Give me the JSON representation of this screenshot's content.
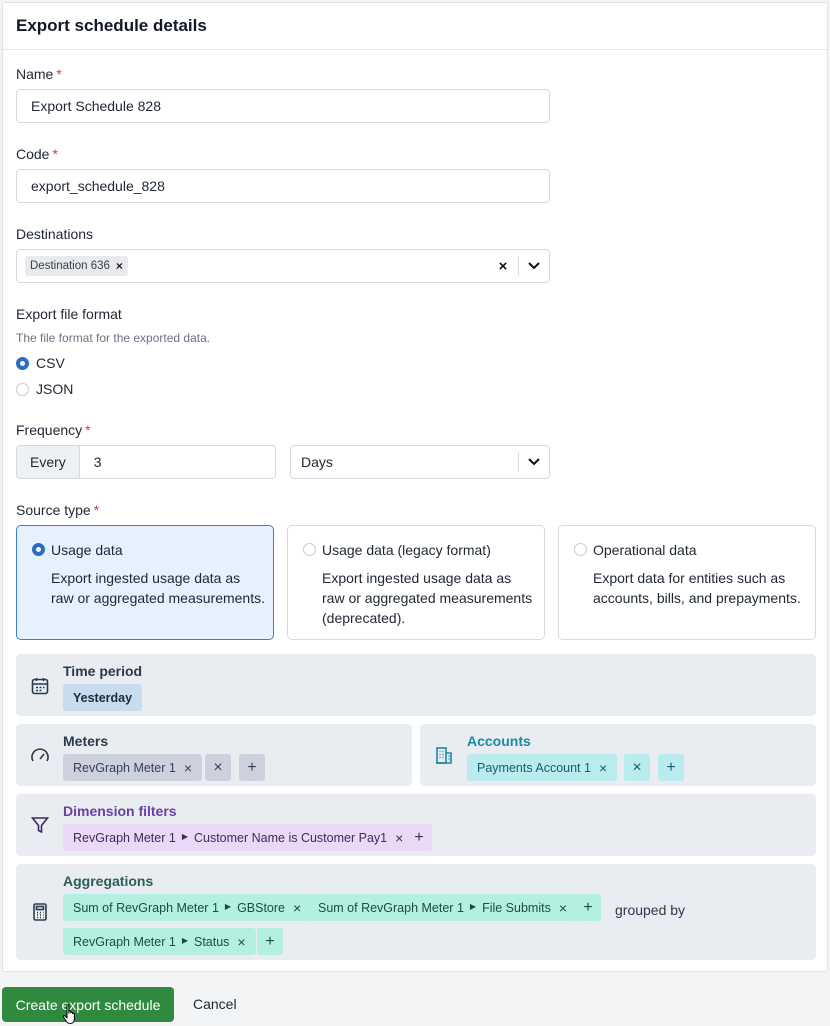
{
  "card": {
    "title": "Export schedule details"
  },
  "name": {
    "label": "Name",
    "required": "*",
    "value": "Export Schedule 828"
  },
  "code": {
    "label": "Code",
    "required": "*",
    "value": "export_schedule_828"
  },
  "destinations": {
    "label": "Destinations",
    "chips": [
      "Destination 636"
    ]
  },
  "file_format": {
    "label": "Export file format",
    "help": "The file format for the exported data.",
    "options": [
      {
        "label": "CSV",
        "selected": true
      },
      {
        "label": "JSON",
        "selected": false
      }
    ]
  },
  "frequency": {
    "label": "Frequency",
    "required": "*",
    "prefix": "Every",
    "value": "3",
    "unit": "Days"
  },
  "source_type": {
    "label": "Source type",
    "required": "*",
    "options": [
      {
        "title": "Usage data",
        "description": "Export ingested usage data as raw or aggregated measurements.",
        "selected": true
      },
      {
        "title": "Usage data (legacy format)",
        "description": "Export ingested usage data as raw or aggregated measurements (deprecated).",
        "selected": false
      },
      {
        "title": "Operational data",
        "description": "Export data for entities such as accounts, bills, and prepayments.",
        "selected": false
      }
    ]
  },
  "time_period": {
    "title": "Time period",
    "value": "Yesterday",
    "icon": "calendar-icon"
  },
  "meters": {
    "title": "Meters",
    "chips": [
      "RevGraph Meter 1"
    ],
    "icon": "gauge-icon"
  },
  "accounts": {
    "title": "Accounts",
    "chips": [
      "Payments Account 1"
    ],
    "icon": "building-icon"
  },
  "dimension_filters": {
    "title": "Dimension filters",
    "icon": "filter-icon",
    "chips": [
      {
        "meter": "RevGraph Meter 1",
        "condition": "Customer Name is Customer Pay1"
      }
    ]
  },
  "aggregations": {
    "title": "Aggregations",
    "icon": "calculator-icon",
    "items": [
      {
        "label": "Sum of RevGraph Meter 1",
        "field": "GBStore"
      },
      {
        "label": "Sum of RevGraph Meter 1",
        "field": "File Submits"
      }
    ],
    "grouped_by_label": "grouped by",
    "group_by": [
      {
        "meter": "RevGraph Meter 1",
        "field": "Status"
      }
    ]
  },
  "actions": {
    "submit": "Create export schedule",
    "cancel": "Cancel"
  },
  "colors": {
    "primary": "#2f8a3f",
    "selected": "#2b6cc4",
    "required": "#d9383a"
  }
}
